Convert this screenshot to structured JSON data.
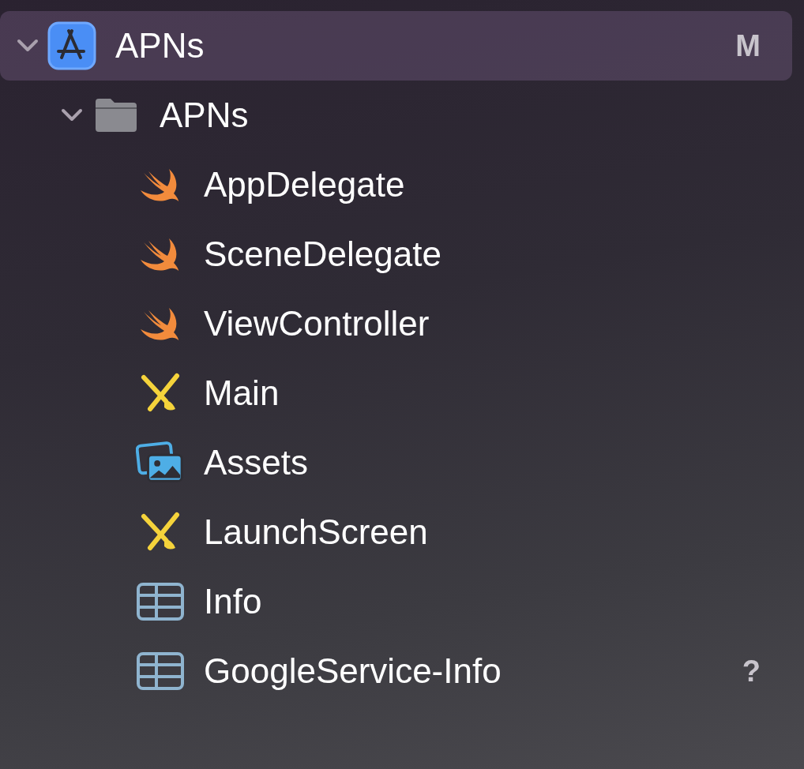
{
  "navigator": {
    "items": [
      {
        "name": "APNs",
        "kind": "project",
        "expanded": true,
        "selected": true,
        "status": "M",
        "children": [
          {
            "name": "APNs",
            "kind": "folder",
            "expanded": true,
            "selected": false,
            "children": [
              {
                "name": "AppDelegate",
                "kind": "swift",
                "selected": false
              },
              {
                "name": "SceneDelegate",
                "kind": "swift",
                "selected": false
              },
              {
                "name": "ViewController",
                "kind": "swift",
                "selected": false
              },
              {
                "name": "Main",
                "kind": "storyboard",
                "selected": false
              },
              {
                "name": "Assets",
                "kind": "assets",
                "selected": false
              },
              {
                "name": "LaunchScreen",
                "kind": "storyboard",
                "selected": false
              },
              {
                "name": "Info",
                "kind": "plist",
                "selected": false
              },
              {
                "name": "GoogleService-Info",
                "kind": "plist",
                "selected": false,
                "status": "?"
              }
            ]
          }
        ]
      }
    ]
  }
}
